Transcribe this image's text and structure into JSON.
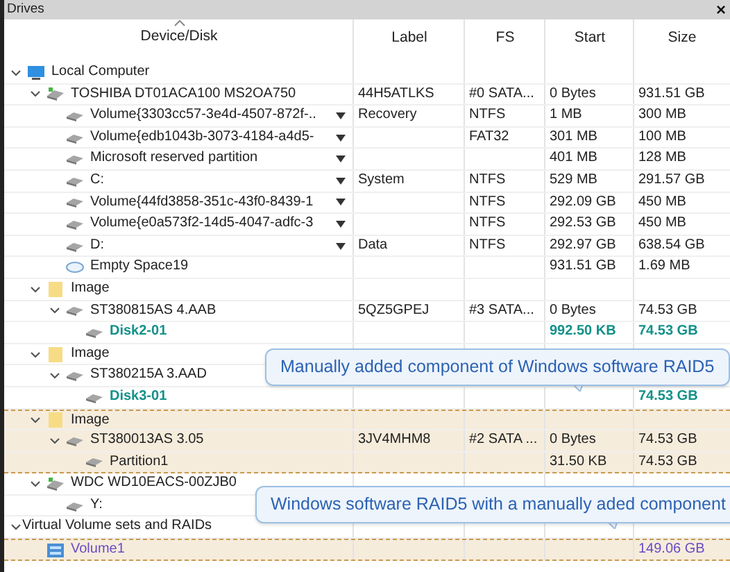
{
  "panel": {
    "title": "Drives",
    "close": "×"
  },
  "columns": [
    "Device/Disk",
    "Label",
    "FS",
    "Start",
    "Size"
  ],
  "tree": [
    {
      "name": "Local Computer",
      "kind": "computer",
      "expanded": true,
      "highlighted": false,
      "children": [
        {
          "name": "TOSHIBA DT01ACA100 MS2OA750",
          "kind": "physical_disk",
          "expanded": true,
          "highlighted": false,
          "label": "44H5ATLKS",
          "fs": "#0 SATA...",
          "start": "0 Bytes",
          "size": "931.51 GB",
          "children": [
            {
              "name": "Volume{3303cc57-3e4d-4507-872f-..",
              "kind": "volume",
              "dropdown": true,
              "highlighted": false,
              "label": "Recovery",
              "fs": "NTFS",
              "start": "1 MB",
              "size": "300 MB"
            },
            {
              "name": "Volume{edb1043b-3073-4184-a4d5-",
              "kind": "volume",
              "dropdown": true,
              "highlighted": false,
              "fs": "FAT32",
              "start": "301 MB",
              "size": "100 MB"
            },
            {
              "name": "Microsoft reserved partition",
              "kind": "volume",
              "dropdown": true,
              "highlighted": false,
              "start": "401 MB",
              "size": "128 MB"
            },
            {
              "name": "C:",
              "kind": "volume",
              "dropdown": true,
              "highlighted": false,
              "label": "System",
              "fs": "NTFS",
              "start": "529 MB",
              "size": "291.57 GB"
            },
            {
              "name": "Volume{44fd3858-351c-43f0-8439-1",
              "kind": "volume",
              "dropdown": true,
              "highlighted": false,
              "fs": "NTFS",
              "start": "292.09 GB",
              "size": "450 MB"
            },
            {
              "name": "Volume{e0a573f2-14d5-4047-adfc-3",
              "kind": "volume",
              "dropdown": true,
              "highlighted": false,
              "fs": "NTFS",
              "start": "292.53 GB",
              "size": "450 MB"
            },
            {
              "name": "D:",
              "kind": "volume",
              "dropdown": true,
              "highlighted": false,
              "label": "Data",
              "fs": "NTFS",
              "start": "292.97 GB",
              "size": "638.54 GB"
            },
            {
              "name": "Empty Space19",
              "kind": "empty",
              "dropdown": false,
              "highlighted": false,
              "start": "931.51 GB",
              "size": "1.69 MB"
            }
          ]
        },
        {
          "name": "Image",
          "kind": "folder",
          "expanded": true,
          "highlighted": false,
          "children": [
            {
              "name": "ST380815AS 4.AAB",
              "kind": "volume",
              "expanded": true,
              "highlighted": false,
              "label": "5QZ5GPEJ",
              "fs": "#3 SATA...",
              "start": "0 Bytes",
              "size": "74.53 GB",
              "children": [
                {
                  "name": "Disk2-01",
                  "kind": "volume",
                  "highlighted": false,
                  "color": "#13918a",
                  "bold": true,
                  "start": "992.50 KB",
                  "size": "74.53 GB"
                }
              ]
            }
          ]
        },
        {
          "name": "Image",
          "kind": "folder",
          "expanded": true,
          "highlighted": false,
          "children": [
            {
              "name": "ST380215A 3.AAD",
              "kind": "volume",
              "expanded": true,
              "highlighted": false,
              "children": [
                {
                  "name": "Disk3-01",
                  "kind": "volume",
                  "highlighted": false,
                  "color": "#13918a",
                  "bold": true,
                  "size": "74.53 GB"
                }
              ]
            }
          ]
        },
        {
          "name": "Image",
          "kind": "folder",
          "expanded": true,
          "highlighted": true,
          "children": [
            {
              "name": "ST380013AS 3.05",
              "kind": "volume",
              "expanded": true,
              "highlighted": true,
              "label": "3JV4MHM8",
              "fs": "#2 SATA ...",
              "start": "0 Bytes",
              "size": "74.53 GB",
              "children": [
                {
                  "name": "Partition1",
                  "kind": "volume",
                  "highlighted": true,
                  "start": "31.50 KB",
                  "size": "74.53 GB"
                }
              ]
            }
          ]
        },
        {
          "name": "WDC WD10EACS-00ZJB0",
          "kind": "physical_disk",
          "expanded": true,
          "highlighted": false,
          "children": [
            {
              "name": "Y:",
              "kind": "volume",
              "highlighted": false
            }
          ]
        }
      ]
    },
    {
      "name": "Virtual Volume sets and RAIDs",
      "kind": "group",
      "expanded": true,
      "highlighted": false,
      "children": [
        {
          "name": "Volume1",
          "kind": "volume_set",
          "highlighted": true,
          "color": "#6a4bc4",
          "size": "149.06 GB"
        }
      ]
    }
  ],
  "callouts": [
    {
      "text": "Manually added component of Windows software RAID5"
    },
    {
      "text": "Windows software RAID5 with a manually aded component"
    }
  ]
}
